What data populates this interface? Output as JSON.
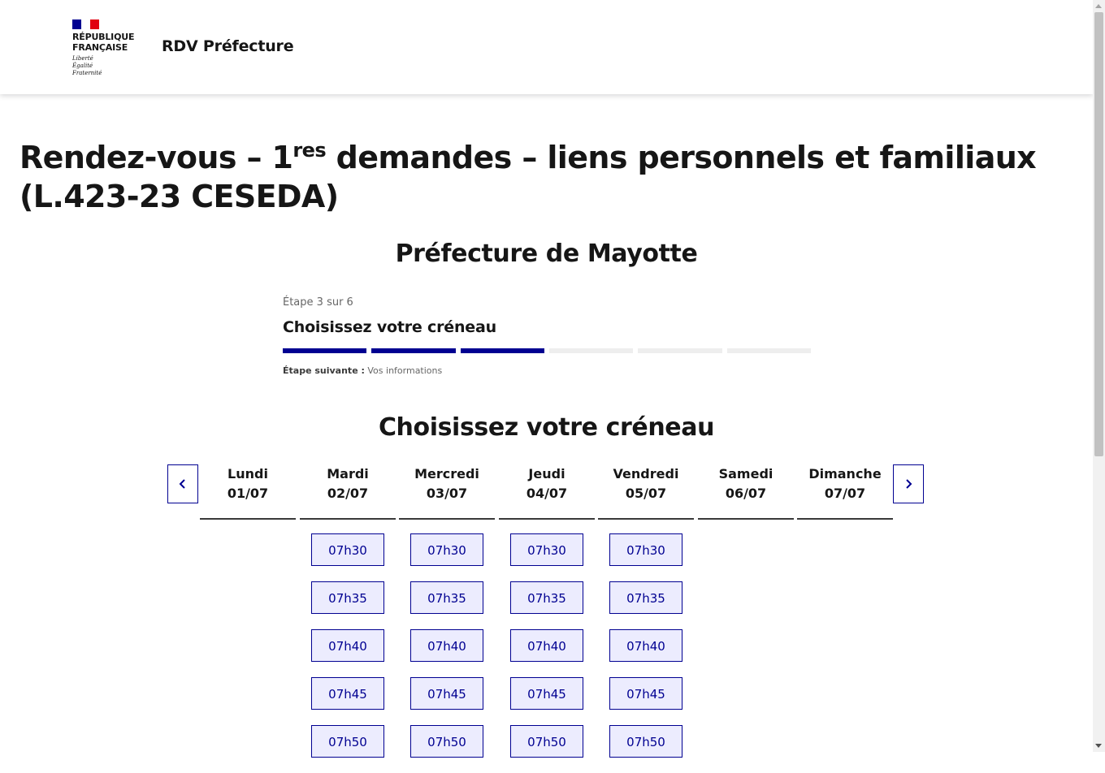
{
  "header": {
    "republic_line1": "République",
    "republic_line2": "Française",
    "motto_line1": "Liberté",
    "motto_line2": "Égalité",
    "motto_line3": "Fraternité",
    "service_name": "RDV Préfecture"
  },
  "page": {
    "title_before": "Rendez-vous – 1",
    "title_sup": "res",
    "title_after": " demandes – liens personnels et familiaux (L.423-23 CESEDA)",
    "office": "Préfecture de Mayotte"
  },
  "stepper": {
    "count": "Étape 3 sur 6",
    "title": "Choisissez votre créneau",
    "current": 3,
    "total": 6,
    "next_label": "Étape suivante :",
    "next_value": "Vos informations"
  },
  "calendar": {
    "title": "Choisissez votre créneau",
    "prev_icon": "chevron-left-icon",
    "next_icon": "chevron-right-icon",
    "days": [
      {
        "name": "Lundi",
        "date": "01/07",
        "slots": []
      },
      {
        "name": "Mardi",
        "date": "02/07",
        "slots": [
          "07h30",
          "07h35",
          "07h40",
          "07h45",
          "07h50"
        ]
      },
      {
        "name": "Mercredi",
        "date": "03/07",
        "slots": [
          "07h30",
          "07h35",
          "07h40",
          "07h45",
          "07h50"
        ]
      },
      {
        "name": "Jeudi",
        "date": "04/07",
        "slots": [
          "07h30",
          "07h35",
          "07h40",
          "07h45",
          "07h50"
        ]
      },
      {
        "name": "Vendredi",
        "date": "05/07",
        "slots": [
          "07h30",
          "07h35",
          "07h40",
          "07h45",
          "07h50"
        ]
      },
      {
        "name": "Samedi",
        "date": "06/07",
        "slots": []
      },
      {
        "name": "Dimanche",
        "date": "07/07",
        "slots": []
      }
    ]
  },
  "colors": {
    "primary": "#000091",
    "slot_bg": "#ececfe",
    "flag_blue": "#000091",
    "flag_red": "#e1000f"
  }
}
